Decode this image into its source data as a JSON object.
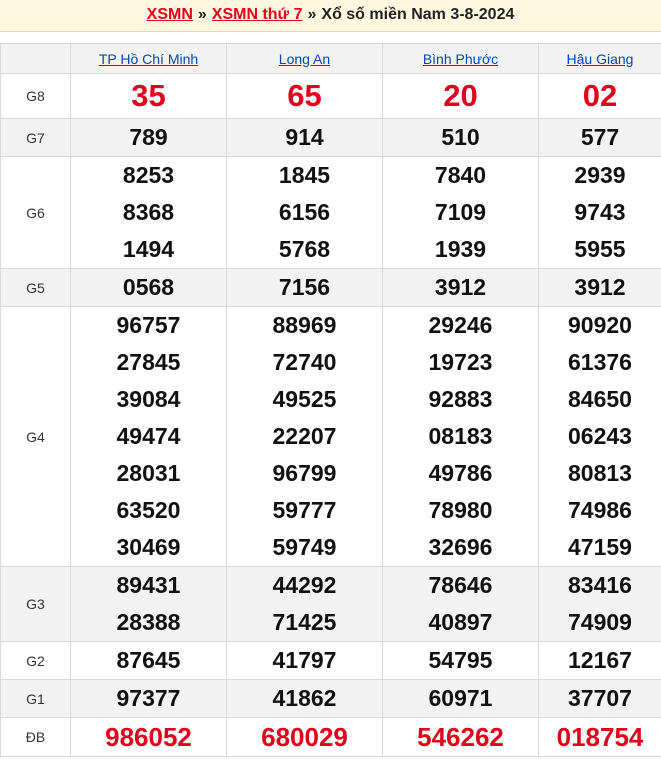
{
  "breadcrumb": {
    "link1": "XSMN",
    "sep1": "»",
    "link2": "XSMN thứ 7",
    "sep2": "»",
    "title": "Xổ số miền Nam 3-8-2024"
  },
  "provinces": [
    "TP Hồ Chí Minh",
    "Long An",
    "Bình Phước",
    "Hậu Giang"
  ],
  "rows": [
    {
      "label": "G8",
      "values": [
        [
          "35"
        ],
        [
          "65"
        ],
        [
          "20"
        ],
        [
          "02"
        ]
      ]
    },
    {
      "label": "G7",
      "values": [
        [
          "789"
        ],
        [
          "914"
        ],
        [
          "510"
        ],
        [
          "577"
        ]
      ]
    },
    {
      "label": "G6",
      "values": [
        [
          "8253",
          "8368",
          "1494"
        ],
        [
          "1845",
          "6156",
          "5768"
        ],
        [
          "7840",
          "7109",
          "1939"
        ],
        [
          "2939",
          "9743",
          "5955"
        ]
      ]
    },
    {
      "label": "G5",
      "values": [
        [
          "0568"
        ],
        [
          "7156"
        ],
        [
          "3912"
        ],
        [
          "3912"
        ]
      ]
    },
    {
      "label": "G4",
      "values": [
        [
          "96757",
          "27845",
          "39084",
          "49474",
          "28031",
          "63520",
          "30469"
        ],
        [
          "88969",
          "72740",
          "49525",
          "22207",
          "96799",
          "59777",
          "59749"
        ],
        [
          "29246",
          "19723",
          "92883",
          "08183",
          "49786",
          "78980",
          "32696"
        ],
        [
          "90920",
          "61376",
          "84650",
          "06243",
          "80813",
          "74986",
          "47159"
        ]
      ]
    },
    {
      "label": "G3",
      "values": [
        [
          "89431",
          "28388"
        ],
        [
          "44292",
          "71425"
        ],
        [
          "78646",
          "40897"
        ],
        [
          "83416",
          "74909"
        ]
      ]
    },
    {
      "label": "G2",
      "values": [
        [
          "87645"
        ],
        [
          "41797"
        ],
        [
          "54795"
        ],
        [
          "12167"
        ]
      ]
    },
    {
      "label": "G1",
      "values": [
        [
          "97377"
        ],
        [
          "41862"
        ],
        [
          "60971"
        ],
        [
          "37707"
        ]
      ]
    },
    {
      "label": "ĐB",
      "values": [
        [
          "986052"
        ],
        [
          "680029"
        ],
        [
          "546262"
        ],
        [
          "018754"
        ]
      ]
    }
  ],
  "colors": {
    "accent_red": "#e2001a",
    "link_blue": "#0645ad",
    "header_bg": "#fff8e1",
    "alt_row_bg": "#f2f2f2"
  }
}
